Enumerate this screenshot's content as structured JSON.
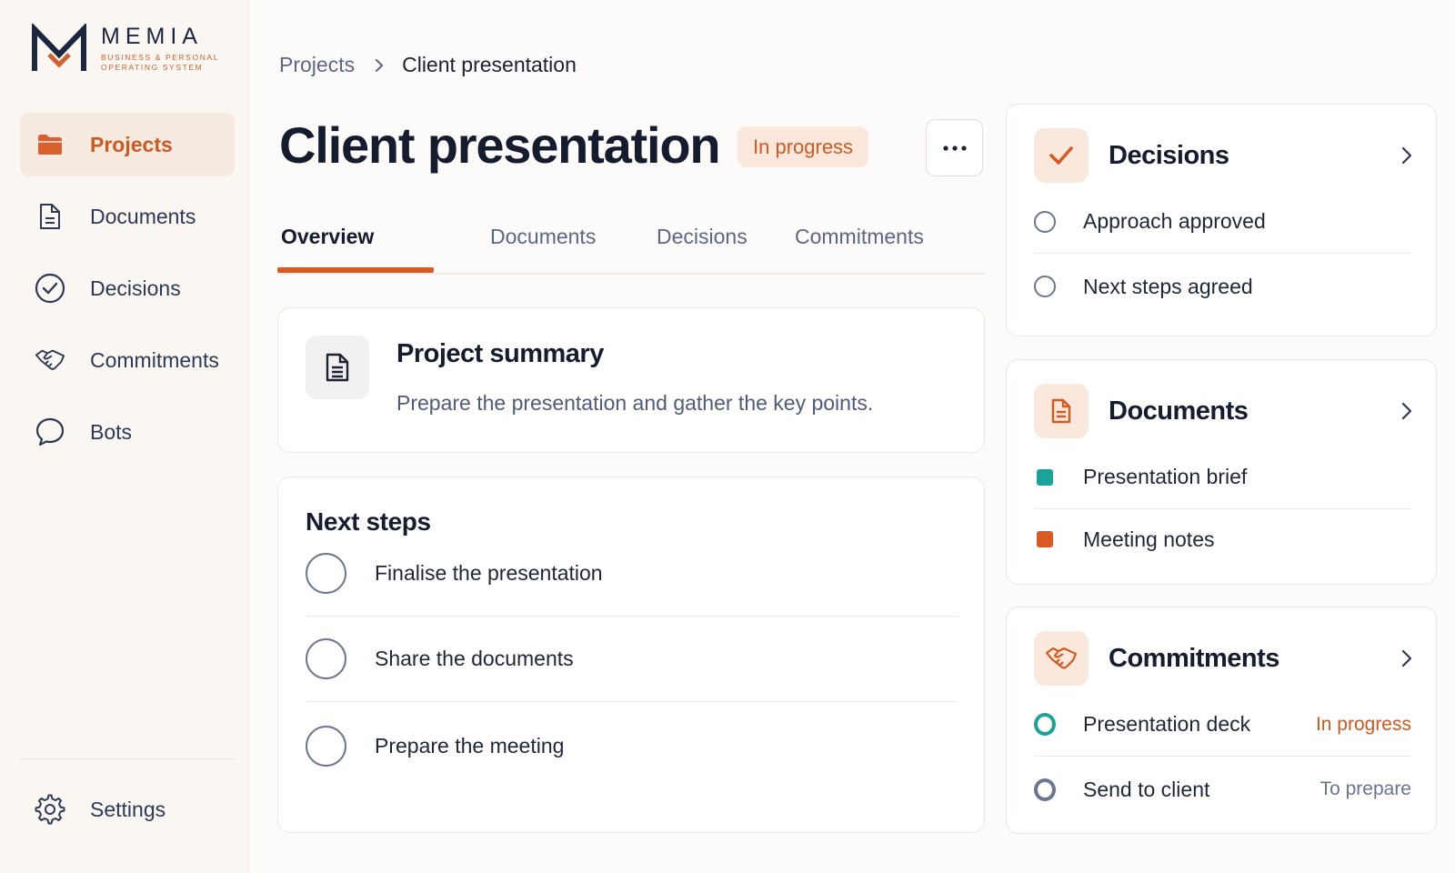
{
  "brand": {
    "name": "MEMIA",
    "tagline": "BUSINESS & PERSONAL OPERATING SYSTEM"
  },
  "sidebar": {
    "items": [
      {
        "label": "Projects",
        "icon": "folder-icon",
        "active": true
      },
      {
        "label": "Documents",
        "icon": "document-icon",
        "active": false
      },
      {
        "label": "Decisions",
        "icon": "check-circle-icon",
        "active": false
      },
      {
        "label": "Commitments",
        "icon": "handshake-icon",
        "active": false
      },
      {
        "label": "Bots",
        "icon": "chat-bubble-icon",
        "active": false
      }
    ],
    "settings_label": "Settings"
  },
  "breadcrumb": {
    "parent": "Projects",
    "current": "Client presentation"
  },
  "page": {
    "title": "Client presentation",
    "status": "In progress"
  },
  "tabs": [
    {
      "label": "Overview",
      "active": true
    },
    {
      "label": "Documents",
      "active": false
    },
    {
      "label": "Decisions",
      "active": false
    },
    {
      "label": "Commitments",
      "active": false
    }
  ],
  "summary": {
    "title": "Project summary",
    "description": "Prepare the presentation and gather the key points."
  },
  "next_steps": {
    "title": "Next steps",
    "items": [
      {
        "label": "Finalise the presentation",
        "done": false
      },
      {
        "label": "Share the documents",
        "done": false
      },
      {
        "label": "Prepare the meeting",
        "done": false
      }
    ]
  },
  "decisions_panel": {
    "title": "Decisions",
    "items": [
      {
        "label": "Approach approved"
      },
      {
        "label": "Next steps agreed"
      }
    ]
  },
  "documents_panel": {
    "title": "Documents",
    "items": [
      {
        "label": "Presentation brief",
        "color": "#1BA39A"
      },
      {
        "label": "Meeting notes",
        "color": "#D85A22"
      }
    ]
  },
  "commitments_panel": {
    "title": "Commitments",
    "items": [
      {
        "label": "Presentation deck",
        "status": "In progress",
        "status_color": "#D2571E"
      },
      {
        "label": "Send to client",
        "status": "To prepare",
        "status_color": "#6A7490"
      }
    ]
  },
  "colors": {
    "accent": "#D75A22",
    "teal": "#1BA39A",
    "sidebar_bg": "#FAF6F2",
    "navy": "#1B2740"
  }
}
